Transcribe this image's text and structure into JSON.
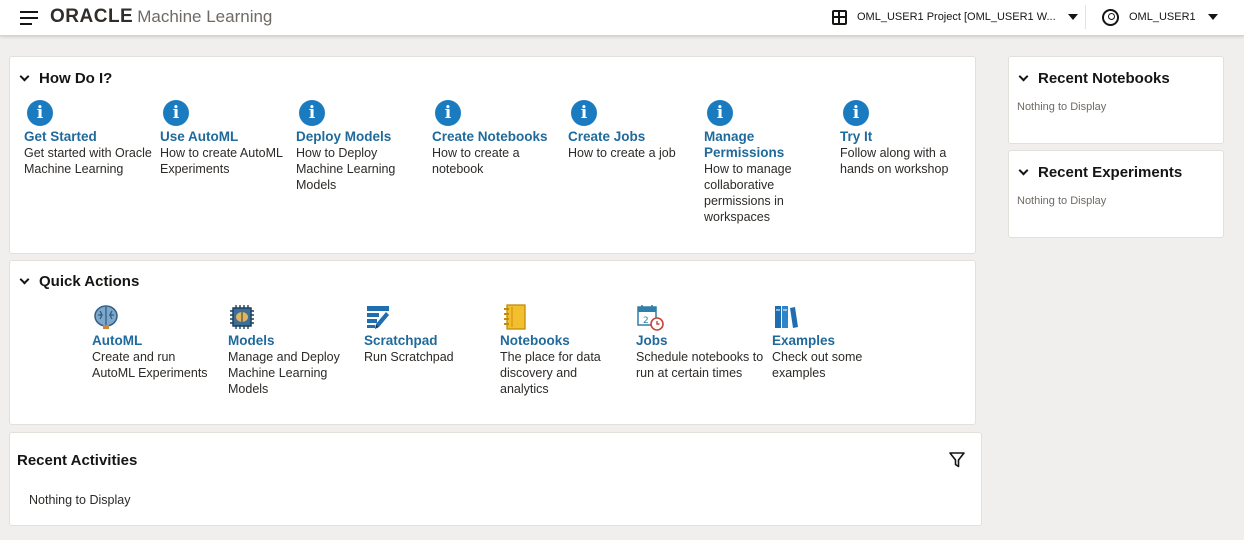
{
  "header": {
    "brand_oracle": "ORACLE",
    "brand_product": "Machine Learning",
    "project_label": "OML_USER1 Project [OML_USER1 W...",
    "user_label": "OML_USER1"
  },
  "howdo": {
    "title": "How Do I?",
    "items": [
      {
        "title": "Get Started",
        "desc": "Get started with Oracle Machine Learning",
        "icon": "info-icon"
      },
      {
        "title": "Use AutoML",
        "desc": "How to create AutoML Experiments",
        "icon": "info-icon"
      },
      {
        "title": "Deploy Models",
        "desc": "How to Deploy Machine Learning Models",
        "icon": "info-icon"
      },
      {
        "title": "Create Notebooks",
        "desc": "How to create a notebook",
        "icon": "info-icon"
      },
      {
        "title": "Create Jobs",
        "desc": "How to create a job",
        "icon": "info-icon"
      },
      {
        "title": "Manage Permissions",
        "desc": "How to manage collaborative permissions in workspaces",
        "icon": "info-icon"
      },
      {
        "title": "Try It",
        "desc": "Follow along with a hands on workshop",
        "icon": "info-icon"
      }
    ]
  },
  "quick_actions": {
    "title": "Quick Actions",
    "items": [
      {
        "title": "AutoML",
        "desc": "Create and run AutoML Experiments",
        "icon": "brain-icon"
      },
      {
        "title": "Models",
        "desc": "Manage and Deploy Machine Learning Models",
        "icon": "model-chip-icon"
      },
      {
        "title": "Scratchpad",
        "desc": "Run Scratchpad",
        "icon": "scratchpad-icon"
      },
      {
        "title": "Notebooks",
        "desc": "The place for data discovery and analytics",
        "icon": "notebook-icon"
      },
      {
        "title": "Jobs",
        "desc": "Schedule notebooks to run at certain times",
        "icon": "calendar-clock-icon"
      },
      {
        "title": "Examples",
        "desc": "Check out some examples",
        "icon": "books-icon"
      }
    ]
  },
  "recent_activities": {
    "title": "Recent Activities",
    "empty": "Nothing to Display"
  },
  "recent_notebooks": {
    "title": "Recent Notebooks",
    "empty": "Nothing to Display"
  },
  "recent_experiments": {
    "title": "Recent Experiments",
    "empty": "Nothing to Display"
  },
  "colors": {
    "link": "#1f6a9b",
    "info_icon": "#1a7bc1",
    "page_bg": "#f1efed"
  }
}
